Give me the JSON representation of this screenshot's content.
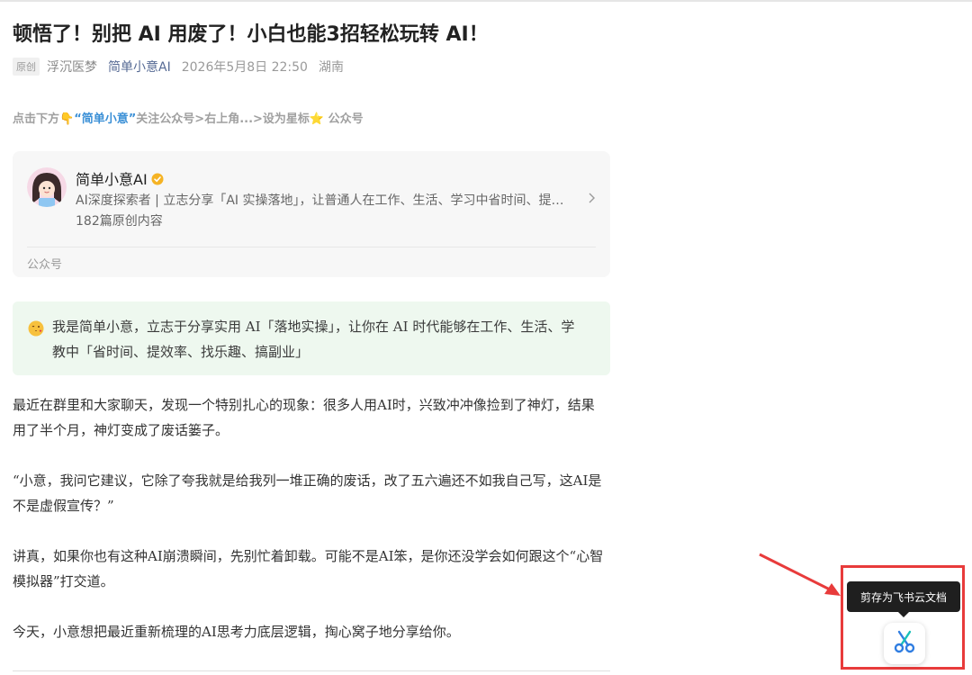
{
  "article": {
    "title": "顿悟了！别把 AI 用废了！小白也能3招轻松玩转 AI！",
    "badge": "原创",
    "author": "浮沉医梦",
    "account": "简单小意AI",
    "time": "2026年5月8日 22:50",
    "location": "湖南"
  },
  "follow_tip": {
    "prefix": "点击下方",
    "pointer_emoji": "👇",
    "highlight": "“简单小意”",
    "middle": "关注公众号>右上角...>设为星标",
    "star_emoji": "⭐",
    "suffix": "公众号"
  },
  "account_card": {
    "name": "简单小意AI",
    "description": "AI深度探索者 | 立志分享「AI 实操落地」，让普通人在工作、生活、学习中省时间、提效率、找乐趣、搞副业",
    "article_count": "182篇原创内容",
    "footer": "公众号"
  },
  "intro": {
    "text": "我是简单小意，立志于分享实用 AI「落地实操」，让你在 AI 时代能够在工作、生活、学教中「省时间、提效率、找乐趣、搞副业」"
  },
  "paragraphs": [
    "最近在群里和大家聊天，发现一个特别扎心的现象：很多人用AI时，兴致冲冲像捡到了神灯，结果用了半个月，神灯变成了废话篓子。",
    "“小意，我问它建议，它除了夸我就是给我列一堆正确的废话，改了五六遍还不如我自己写，这AI是不是虚假宣传？”",
    "讲真，如果你也有这种AI崩溃瞬间，先别忙着卸载。可能不是AI笨，是你还没学会如何跟这个“心智模拟器”打交道。",
    "今天，小意想把最近重新梳理的AI思考力底层逻辑，掏心窝子地分享给你。"
  ],
  "clip_tool": {
    "tooltip": "剪存为飞书云文档",
    "icon": "scissors-icon"
  },
  "colors": {
    "accent_link": "#576b95",
    "highlight_blue": "#3a8fd6",
    "annotation_red": "#e83b3b",
    "intro_bg": "#eef8ef"
  }
}
